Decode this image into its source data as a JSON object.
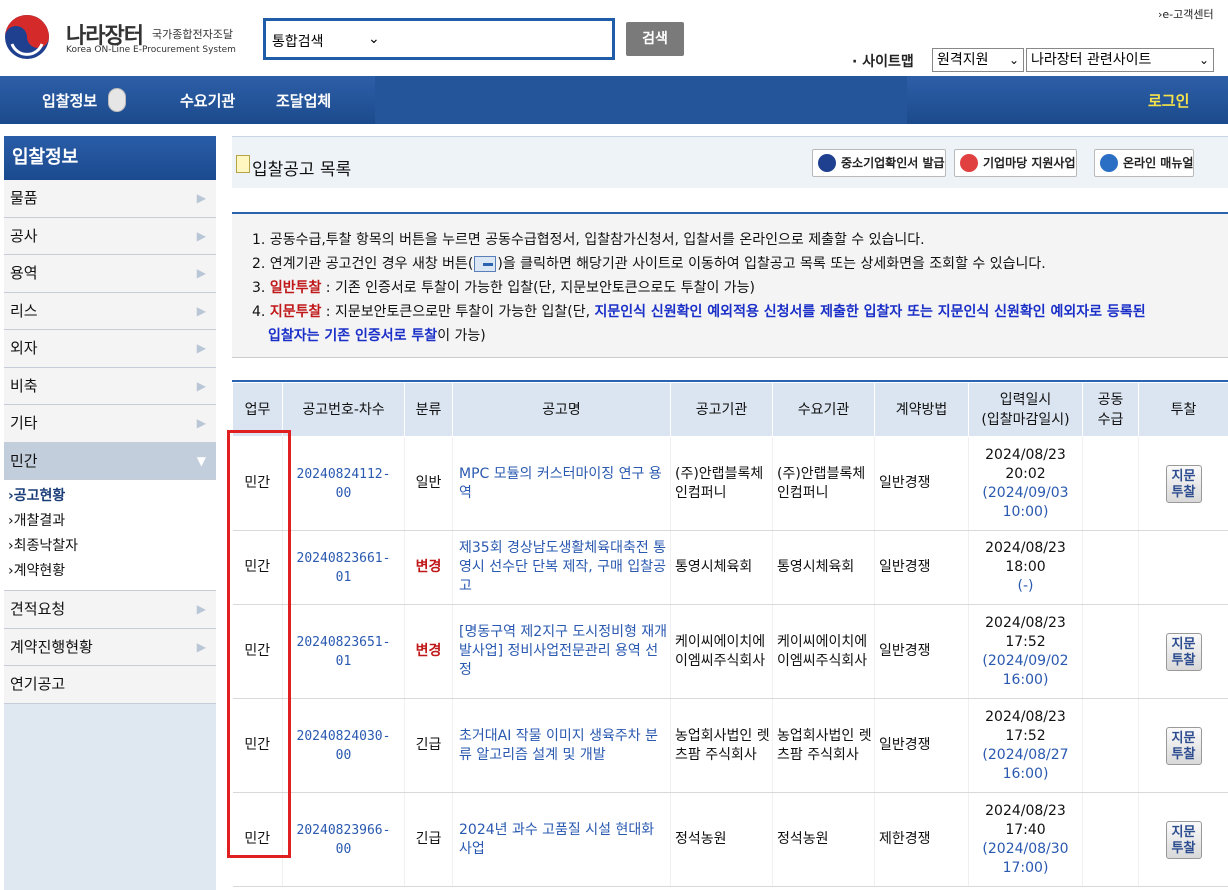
{
  "header": {
    "logo_name": "나라장터",
    "logo_sub": "국가종합전자조달",
    "logo_eng": "Korea ON-Line E-Procurement System",
    "search_select": "통합검색",
    "search_button": "검색",
    "e_center": "›e-고객센터",
    "sitemap": "· 사이트맵",
    "remote_select": "원격지원",
    "related_select": "나라장터 관련사이트"
  },
  "nav": {
    "items": [
      "입찰정보",
      "수요기관",
      "조달업체"
    ],
    "login": "로그인"
  },
  "sidebar": {
    "title": "입찰정보",
    "items": [
      "물품",
      "공사",
      "용역",
      "리스",
      "외자",
      "비축",
      "기타",
      "민간"
    ],
    "sub_items": [
      "›공고현황",
      "›개찰결과",
      "›최종낙찰자",
      "›계약현황"
    ],
    "bottom_items": [
      "견적요청",
      "계약진행현황",
      "연기공고"
    ]
  },
  "content": {
    "title": "입찰공고 목록",
    "buttons": [
      "중소기업확인서 발급",
      "기업마당 지원사업",
      "온라인 매뉴얼"
    ],
    "notice": {
      "line1": "1. 공동수급,투찰 항목의 버튼을 누르면 공동수급협정서, 입찰참가신청서, 입찰서를 온라인으로 제출할 수 있습니다.",
      "line2a": "2. 연계기관 공고건인 경우 새창 버튼(",
      "line2b": ")을 클릭하면 해당기관 사이트로 이동하여 입찰공고 목록 또는 상세화면을 조회할 수 있습니다.",
      "line3_prefix": "3. ",
      "line3_red": "일반투찰",
      "line3_rest": " : 기존 인증서로 투찰이 가능한 입찰(단, 지문보안토큰으로도 투찰이 가능)",
      "line4_prefix": "4. ",
      "line4_red": "지문투찰",
      "line4_rest": " : 지문보안토큰으로만 투찰이 가능한 입찰(단, ",
      "line4_blue": "지문인식 신원확인 예외적용 신청서를 제출한 입찰자 또는 지문인식 신원확인 예외자로 등록된",
      "line5_blue": "입찰자는 기존 인증서로 투찰",
      "line5_rest": "이 가능)"
    }
  },
  "table": {
    "headers": [
      "업무",
      "공고번호-차수",
      "분류",
      "공고명",
      "공고기관",
      "수요기관",
      "계약방법",
      "입력일시\n(입찰마감일시)",
      "공동\n수급",
      "투찰"
    ],
    "bid_label_1": "지문",
    "bid_label_2": "투찰",
    "rows": [
      {
        "type": "민간",
        "no1": "20240824112-",
        "no2": "00",
        "cls": "일반",
        "cls_red": false,
        "title": "MPC 모듈의 커스터마이징 연구 용역",
        "org": "(주)안랩블록체인컴퍼니",
        "demand": "(주)안랩블록체인컴퍼니",
        "method": "일반경쟁",
        "date": "2024/08/23",
        "time": "20:02",
        "deadline1": "(2024/09/03",
        "deadline2": "10:00)",
        "bid": true
      },
      {
        "type": "민간",
        "no1": "20240823661-",
        "no2": "01",
        "cls": "변경",
        "cls_red": true,
        "title": "제35회 경상남도생활체육대축전 통영시 선수단 단복 제작, 구매 입찰공고",
        "org": "통영시체육회",
        "demand": "통영시체육회",
        "method": "일반경쟁",
        "date": "2024/08/23",
        "time": "18:00",
        "deadline1": "(-)",
        "deadline2": "",
        "bid": false
      },
      {
        "type": "민간",
        "no1": "20240823651-",
        "no2": "01",
        "cls": "변경",
        "cls_red": true,
        "title": "[명동구역 제2지구 도시정비형 재개발사업] 정비사업전문관리 용역 선정",
        "org": "케이씨에이치에이엠씨주식회사",
        "demand": "케이씨에이치에이엠씨주식회사",
        "method": "일반경쟁",
        "date": "2024/08/23",
        "time": "17:52",
        "deadline1": "(2024/09/02",
        "deadline2": "16:00)",
        "bid": true
      },
      {
        "type": "민간",
        "no1": "20240824030-",
        "no2": "00",
        "cls": "긴급",
        "cls_red": false,
        "title": "초거대AI 작물 이미지 생육주차 분류 알고리즘 설계 및 개발",
        "org": "농업회사법인 렛츠팜 주식회사",
        "demand": "농업회사법인 렛츠팜 주식회사",
        "method": "일반경쟁",
        "date": "2024/08/23",
        "time": "17:52",
        "deadline1": "(2024/08/27",
        "deadline2": "16:00)",
        "bid": true
      },
      {
        "type": "민간",
        "no1": "20240823966-",
        "no2": "00",
        "cls": "긴급",
        "cls_red": false,
        "title": "2024년 과수 고품질 시설 현대화 사업",
        "org": "정석농원",
        "demand": "정석농원",
        "method": "제한경쟁",
        "date": "2024/08/23",
        "time": "17:40",
        "deadline1": "(2024/08/30",
        "deadline2": "17:00)",
        "bid": true
      }
    ]
  },
  "colors": {
    "brand_blue": "#1f5da8",
    "change_red": "#c01818",
    "login_yellow": "#f7e24a",
    "highlight_red": "#e02020"
  }
}
